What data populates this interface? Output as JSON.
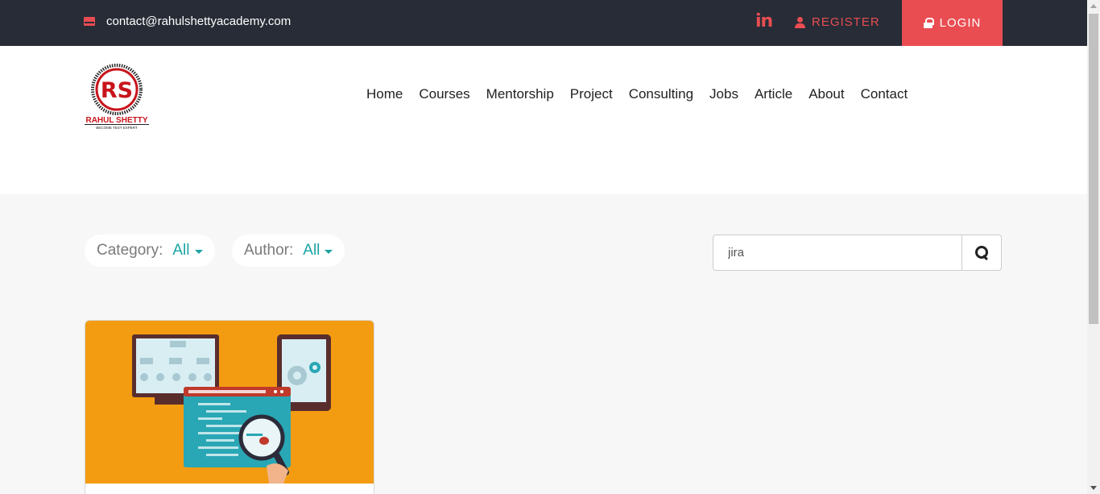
{
  "topbar": {
    "email": "contact@rahulshettyacademy.com",
    "linkedin_label": "in",
    "register_label": "REGISTER",
    "login_label": "LOGIN"
  },
  "logo": {
    "monogram": "RS",
    "name": "RAHUL SHETTY",
    "tagline": "BECOME TEST EXPERT"
  },
  "nav": {
    "items": [
      "Home",
      "Courses",
      "Mentorship",
      "Project",
      "Consulting",
      "Jobs",
      "Article",
      "About",
      "Contact"
    ]
  },
  "filters": {
    "category_label": "Category:",
    "category_value": "All",
    "author_label": "Author:",
    "author_value": "All"
  },
  "search": {
    "value": "jira"
  },
  "colors": {
    "brand_red": "#e94d52",
    "topbar_bg": "#272c36",
    "accent_teal": "#1aa3a3",
    "card_orange": "#f39c12"
  }
}
